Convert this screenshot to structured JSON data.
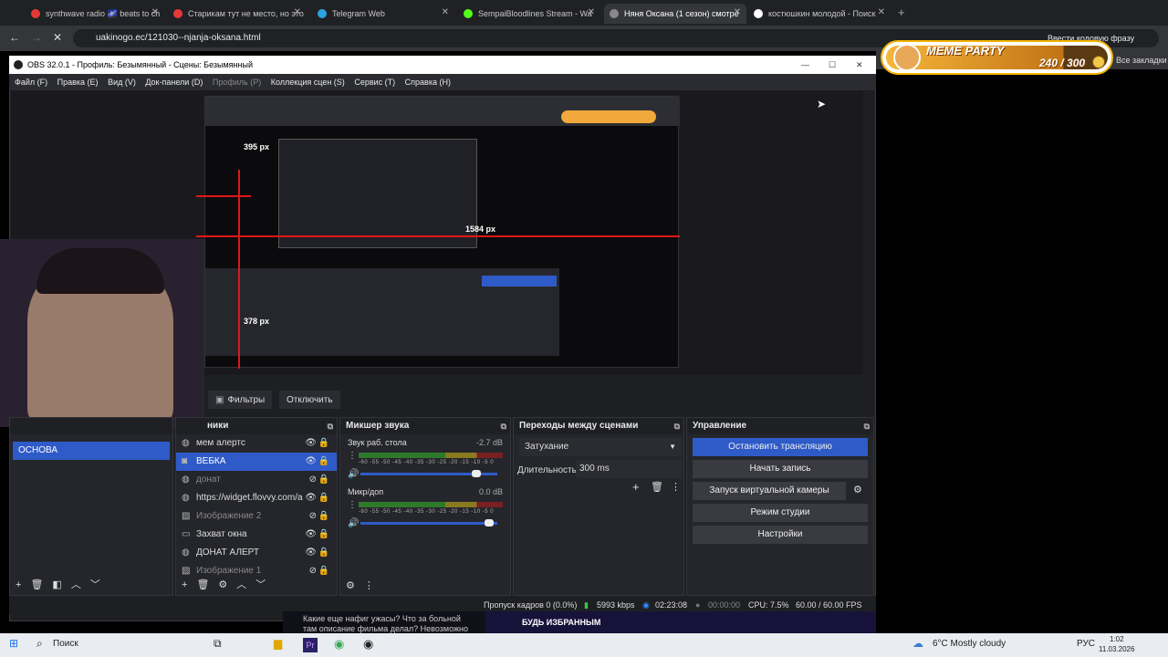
{
  "browser": {
    "tabs": [
      {
        "label": "synthwave radio 🌌 beats to ch",
        "favicon_color": "#e53935"
      },
      {
        "label": "Старикам тут не место, но это",
        "favicon_color": "#e53935"
      },
      {
        "label": "Telegram Web",
        "favicon_color": "#2aa3e0"
      },
      {
        "label": "SempaiBloodlines Stream - Wa",
        "favicon_color": "#53fc18"
      },
      {
        "label": "Няня Оксана (1 сезон) смотре",
        "favicon_color": "#888888"
      },
      {
        "label": "костюшкин молодой - Поиск",
        "favicon_color": "#ffffff"
      }
    ],
    "url": "uakinogo.ec/121030--njanja-oksana.html",
    "extension_label": "Ввести кодовую фразу",
    "bookmarks_label": "Все закладки"
  },
  "meme_widget": {
    "title": "MEME PARTY",
    "progress_text": "240 / 300",
    "progress_fraction": 0.8
  },
  "obs": {
    "title": "OBS 32.0.1 - Профиль: Безымянный - Сцены: Безымянный",
    "menu": [
      "Файл (F)",
      "Правка (E)",
      "Вид (V)",
      "Док-панели (D)",
      "Профиль (P)",
      "Коллекция сцен (S)",
      "Сервис (T)",
      "Справка (H)"
    ],
    "preview_labels": {
      "dim1": "395 px",
      "dim2": "1584 px",
      "dim3": "378 px"
    },
    "filters_button": "Фильтры",
    "disable_button": "Отключить",
    "scenes": {
      "items": [
        "ОСНОВА"
      ]
    },
    "sources": {
      "title": "ники",
      "items": [
        {
          "label": "мем алертс",
          "icon": "globe-icon",
          "visible": true
        },
        {
          "label": "ВЕБКА",
          "icon": "camera-icon",
          "visible": true,
          "selected": true
        },
        {
          "label": "донат",
          "icon": "globe-icon",
          "visible": false
        },
        {
          "label": "https://widget.flovvy.com/a",
          "icon": "globe-icon",
          "visible": true
        },
        {
          "label": "Изображение 2",
          "icon": "image-icon",
          "visible": false
        },
        {
          "label": "Захват окна",
          "icon": "window-icon",
          "visible": true
        },
        {
          "label": "ДОНАТ АЛЕРТ",
          "icon": "globe-icon",
          "visible": true
        },
        {
          "label": "Изображение 1",
          "icon": "image-icon",
          "visible": false
        }
      ]
    },
    "mixer": {
      "title": "Микшер звука",
      "channels": [
        {
          "name": "Звук раб. стола",
          "db": "-2.7 dB",
          "fader": 0.88
        },
        {
          "name": "Микр/доп",
          "db": "0.0 dB",
          "fader": 0.97
        }
      ],
      "scale": [
        "-60",
        "-55",
        "-50",
        "-45",
        "-40",
        "-35",
        "-30",
        "-25",
        "-20",
        "-15",
        "-10",
        "-5",
        "0"
      ]
    },
    "transitions": {
      "title": "Переходы между сценами",
      "selected": "Затухание",
      "duration_label": "Длительность",
      "duration_value": "300 ms"
    },
    "controls": {
      "title": "Управление",
      "buttons": [
        "Остановить трансляцию",
        "Начать запись",
        "Запуск виртуальной камеры",
        "Режим студии",
        "Настройки"
      ]
    },
    "status": {
      "dropped": "Пропуск кадров 0 (0.0%)",
      "bitrate": "5993 kbps",
      "stream_time": "02:23:08",
      "rec_time": "00:00:00",
      "cpu": "CPU: 7.5%",
      "fps": "60.00 / 60.00 FPS"
    }
  },
  "behind_text": [
    "Какие еще нафиг ужасы? Что за больной",
    "там описание фильма делал? Невозможно"
  ],
  "behind_banner": "БУДЬ ИЗБРАННЫМ",
  "taskbar": {
    "search": "Поиск",
    "weather": "6°C  Mostly cloudy",
    "lang": "РУС",
    "time": "1:02",
    "date": "11.03.2026"
  },
  "colors": {
    "accent": "#2f5bc8",
    "red": "#e01616"
  }
}
